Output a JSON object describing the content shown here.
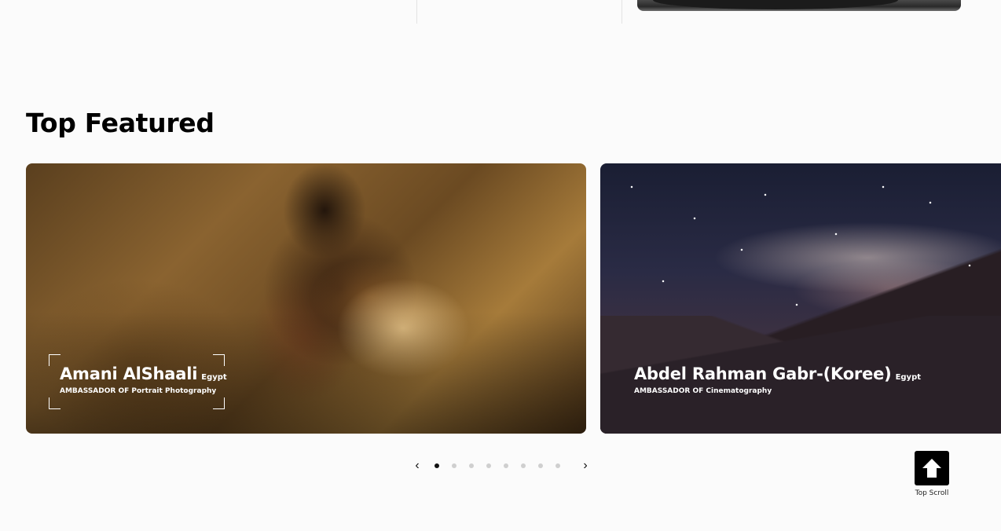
{
  "section": {
    "title": "Top Featured"
  },
  "cards": [
    {
      "name": "Amani AlShaali",
      "country": "Egypt",
      "role": "AMBASSADOR OF Portrait Photography",
      "image": "portrait-photo"
    },
    {
      "name": "Abdel Rahman Gabr-(Koree)",
      "country": "Egypt",
      "role": "AMBASSADOR OF Cinematography",
      "image": "milky-way-night-landscape"
    }
  ],
  "pagination": {
    "prev_icon": "chevron-left-icon",
    "next_icon": "chevron-right-icon",
    "prev_glyph": "‹",
    "next_glyph": "›",
    "total_pages": 8,
    "active_page": 1
  },
  "top_scroll": {
    "label": "Top Scroll",
    "icon": "arrow-up-icon"
  },
  "colors": {
    "background": "#fbfbfb",
    "title": "#000000",
    "dot_active": "#111111",
    "dot_inactive": "#cfcfcf",
    "top_scroll_bg": "#000000"
  }
}
